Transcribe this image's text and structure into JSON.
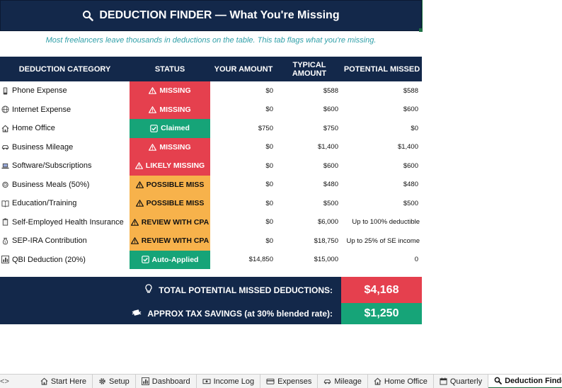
{
  "title": {
    "text": "DEDUCTION FINDER — What You're Missing",
    "icon": "magnifier-icon"
  },
  "subtitle": "Most freelancers leave thousands in deductions on the table. This tab flags what you're missing.",
  "table": {
    "headers": [
      "DEDUCTION CATEGORY",
      "STATUS",
      "YOUR AMOUNT",
      "TYPICAL AMOUNT",
      "POTENTIAL MISSED"
    ],
    "rows": [
      {
        "icon": "phone-icon",
        "category": "Phone Expense",
        "status_icon": "warning-icon",
        "status": "MISSING",
        "status_type": "missing",
        "your": "$0",
        "typical": "$588",
        "missed": "$588"
      },
      {
        "icon": "globe-icon",
        "category": "Internet Expense",
        "status_icon": "warning-icon",
        "status": "MISSING",
        "status_type": "missing",
        "your": "$0",
        "typical": "$600",
        "missed": "$600"
      },
      {
        "icon": "house-icon",
        "category": "Home Office",
        "status_icon": "checkbox-icon",
        "status": "Claimed",
        "status_type": "claimed",
        "your": "$750",
        "typical": "$750",
        "missed": "$0"
      },
      {
        "icon": "car-icon",
        "category": "Business Mileage",
        "status_icon": "warning-icon",
        "status": "MISSING",
        "status_type": "missing",
        "your": "$0",
        "typical": "$1,400",
        "missed": "$1,400"
      },
      {
        "icon": "laptop-icon",
        "category": "Software/Subscriptions",
        "status_icon": "warning-icon",
        "status": "LIKELY MISSING",
        "status_type": "missing",
        "your": "$0",
        "typical": "$600",
        "missed": "$600"
      },
      {
        "icon": "meal-icon",
        "category": "Business Meals (50%)",
        "status_icon": "warning-icon",
        "status": "POSSIBLE MISS",
        "status_type": "possible",
        "your": "$0",
        "typical": "$480",
        "missed": "$480"
      },
      {
        "icon": "book-icon",
        "category": "Education/Training",
        "status_icon": "warning-icon",
        "status": "POSSIBLE MISS",
        "status_type": "possible",
        "your": "$0",
        "typical": "$500",
        "missed": "$500"
      },
      {
        "icon": "clipboard-icon",
        "category": "Self-Employed Health Insurance",
        "status_icon": "warning-icon",
        "status": "REVIEW WITH CPA",
        "status_type": "possible",
        "your": "$0",
        "typical": "$6,000",
        "missed": "Up to 100% deductible"
      },
      {
        "icon": "moneybag-icon",
        "category": "SEP-IRA Contribution",
        "status_icon": "warning-icon",
        "status": "REVIEW WITH CPA",
        "status_type": "possible",
        "your": "$0",
        "typical": "$18,750",
        "missed": "Up to 25% of SE income"
      },
      {
        "icon": "chart-icon",
        "category": "QBI Deduction (20%)",
        "status_icon": "checkbox-icon",
        "status": "Auto-Applied",
        "status_type": "claimed",
        "your": "$14,850",
        "typical": "$15,000",
        "missed": "0"
      }
    ]
  },
  "totals": {
    "missed_label": "TOTAL POTENTIAL MISSED DEDUCTIONS:",
    "missed_icon": "lightbulb-icon",
    "missed_value": "$4,168",
    "savings_label": "APPROX TAX SAVINGS (at 30% blended rate):",
    "savings_icon": "money-wings-icon",
    "savings_value": "$1,250"
  },
  "tabbar": {
    "prev": "<",
    "next": ">",
    "tabs": [
      {
        "label": "Start Here",
        "icon": "house-icon",
        "active": false
      },
      {
        "label": "Setup",
        "icon": "gear-icon",
        "active": false
      },
      {
        "label": "Dashboard",
        "icon": "chart-icon",
        "active": false
      },
      {
        "label": "Income Log",
        "icon": "cash-icon",
        "active": false
      },
      {
        "label": "Expenses",
        "icon": "card-icon",
        "active": false
      },
      {
        "label": "Mileage",
        "icon": "car-icon",
        "active": false
      },
      {
        "label": "Home Office",
        "icon": "house-icon",
        "active": false
      },
      {
        "label": "Quarterly",
        "icon": "calendar-icon",
        "active": false
      },
      {
        "label": "Deduction Finder",
        "icon": "magnifier-icon",
        "active": true
      }
    ]
  },
  "colors": {
    "navy": "#13284a",
    "missing": "#e5404e",
    "claimed": "#16a478",
    "possible": "#f7b24b",
    "subtitle": "#2f9fa8"
  }
}
